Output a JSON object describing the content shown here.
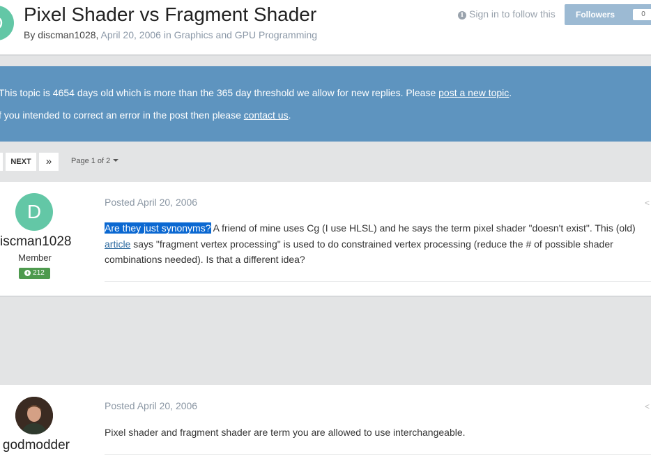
{
  "header": {
    "avatar_letter": "D",
    "title": "Pixel Shader vs Fragment Shader",
    "byline_prefix": "By ",
    "author": "discman1028",
    "byline_comma": ", ",
    "date": "April 20, 2006",
    "in_text": " in ",
    "forum": "Graphics and GPU Programming",
    "follow_label": "Sign in to follow this",
    "follow_icon": "info-icon",
    "followers_label": "Followers",
    "followers_count": "0"
  },
  "notice": {
    "line1_text": "This topic is 4654 days old which is more than the 365 day threshold we allow for new replies. Please ",
    "line1_link": "post a new topic",
    "line1_end": ".",
    "line2_text": "f you intended to correct an error in the post then please ",
    "line2_link": "contact us",
    "line2_end": "."
  },
  "pagination": {
    "next_label": "NEXT",
    "last_glyph": "»",
    "page_label": "Page 1 of 2"
  },
  "posts": [
    {
      "avatar_letter": "D",
      "author": "iscman1028",
      "rank": "Member",
      "reputation": "212",
      "date": "Posted April 20, 2006",
      "body_highlight": "Are they just synonyms?",
      "body_l1_rest": " A friend of mine uses Cg (I use HLSL) and he says the term pixel shader \"doesn't exist\". This (old)",
      "body_link": "article",
      "body_l2_rest": " says \"fragment vertex processing\" is used to do constrained vertex processing (reduce the # of possible shader",
      "body_l3": "combinations needed). Is that a different idea?"
    },
    {
      "author": "godmodder",
      "date": "Posted April 20, 2006",
      "body": "Pixel shader and fragment shader are term you are allowed to use interchangeable."
    }
  ],
  "colors": {
    "accent": "#5e94bf",
    "avatar": "#63c7a6",
    "reputation": "#4e9a4e",
    "highlight": "#0b68d1"
  }
}
